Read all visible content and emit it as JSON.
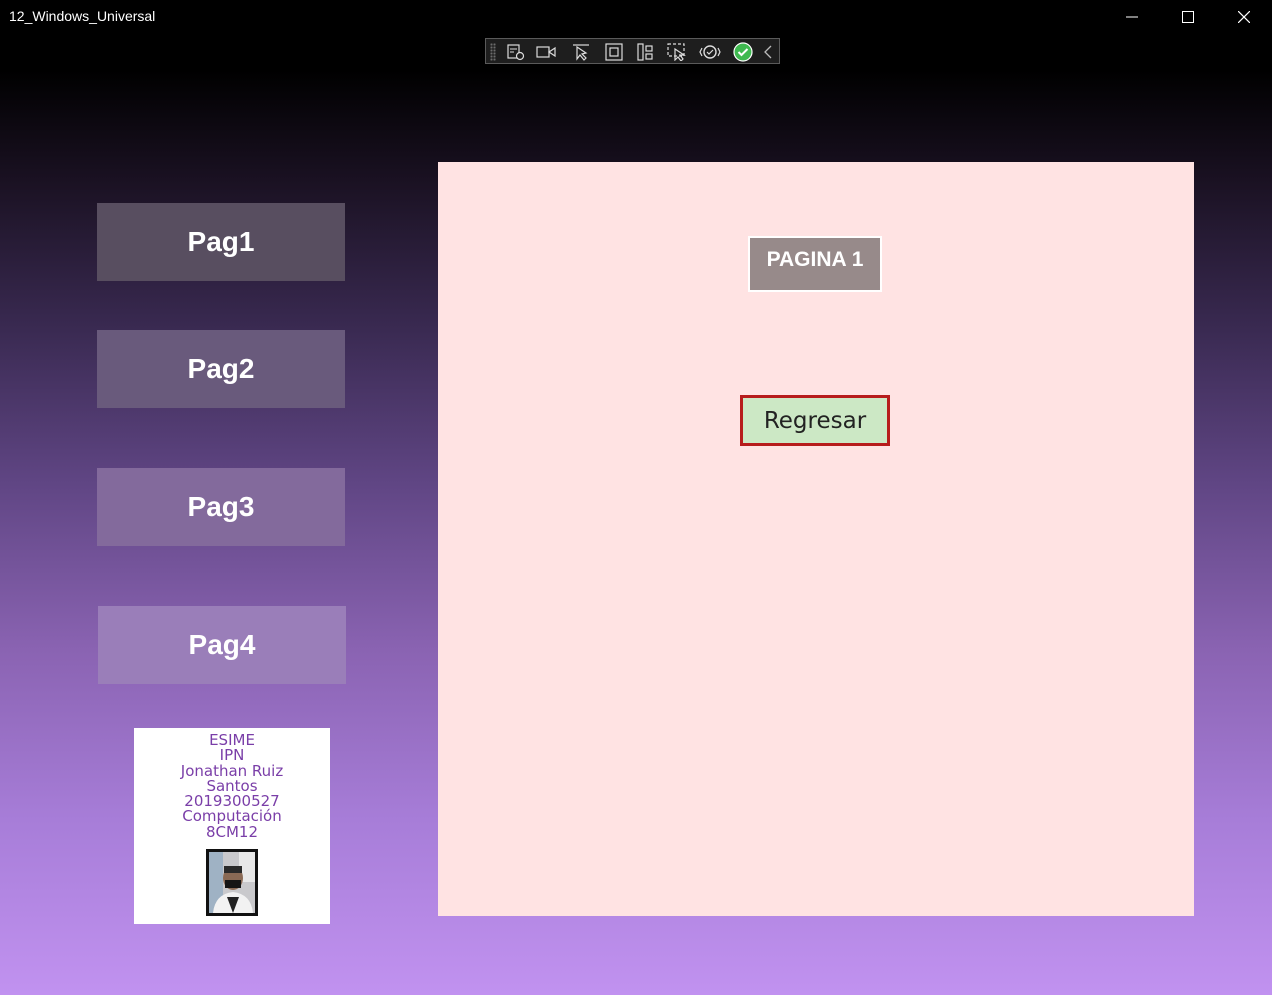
{
  "window": {
    "title": "12_Windows_Universal",
    "controls": [
      "minimize-icon",
      "maximize-icon",
      "close-icon"
    ]
  },
  "debug_toolbar": {
    "icons": [
      "live-visual-tree-icon",
      "record-icon",
      "select-element-icon",
      "display-layout-adorners-icon",
      "track-focus-icon",
      "preview-selection-icon",
      "hot-reload-icon",
      "check-status-icon",
      "collapse-chevron-icon"
    ],
    "status_color": "#3fb950"
  },
  "nav": {
    "buttons": [
      {
        "label": "Pag1",
        "color": "#584e60"
      },
      {
        "label": "Pag2",
        "color": "#695a7c"
      },
      {
        "label": "Pag3",
        "color": "#836a9c"
      },
      {
        "label": "Pag4",
        "color": "#9a7eb9"
      }
    ]
  },
  "info_card": {
    "lines": [
      "ESIME",
      "IPN",
      "Jonathan Ruiz",
      "Santos",
      "2019300527",
      "Computación",
      "8CM12"
    ],
    "text_color": "#7a3ea8"
  },
  "content": {
    "page_label": "PAGINA 1",
    "back_button": "Regresar",
    "background": "#ffe3e3",
    "button_background": "#cce8c5",
    "button_border": "#b71c1c"
  }
}
